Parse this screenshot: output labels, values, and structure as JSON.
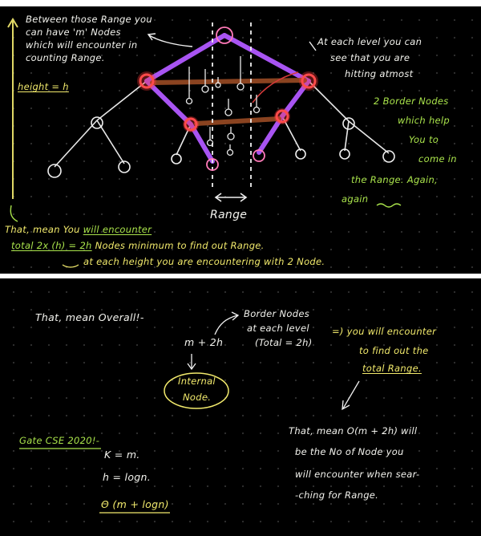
{
  "top": {
    "note_left": [
      "Between those Range you",
      "can have 'm' Nodes",
      "which will encounter in",
      "counting Range."
    ],
    "height_label": "height = h",
    "note_right": [
      "At each level you can",
      "see that you are",
      "hitting atmost",
      "2 Border Nodes",
      "which help",
      "You to",
      "come in",
      "the Range. Again,",
      "again"
    ],
    "range_label": "Range",
    "line1_prefix": "That, mean You ",
    "line1_underlined": "will encounter",
    "line2_underlined": "total 2x (h) = 2h",
    "line2_rest": " Nodes minimum to find out Range.",
    "line3": "at each height you are encountering with 2 Node."
  },
  "bottom": {
    "overall": "That, mean Overall!-",
    "formula": "m + 2h",
    "border_note": [
      "Border Nodes",
      "at each level",
      "(Total = 2h)"
    ],
    "internal_node": [
      "Internal",
      "Node."
    ],
    "encounter_note": [
      "=) you will encounter",
      "to find out the"
    ],
    "total_range": "total Range.",
    "gate": "Gate CSE 2020!-",
    "k_eq": "K = m.",
    "h_eq": "h = logn.",
    "theta": "Θ (m + logn)",
    "conclusion": [
      "That, mean O(m + 2h) will",
      "be the No of Node you",
      "will encounter when sear-",
      "-ching for Range."
    ]
  }
}
